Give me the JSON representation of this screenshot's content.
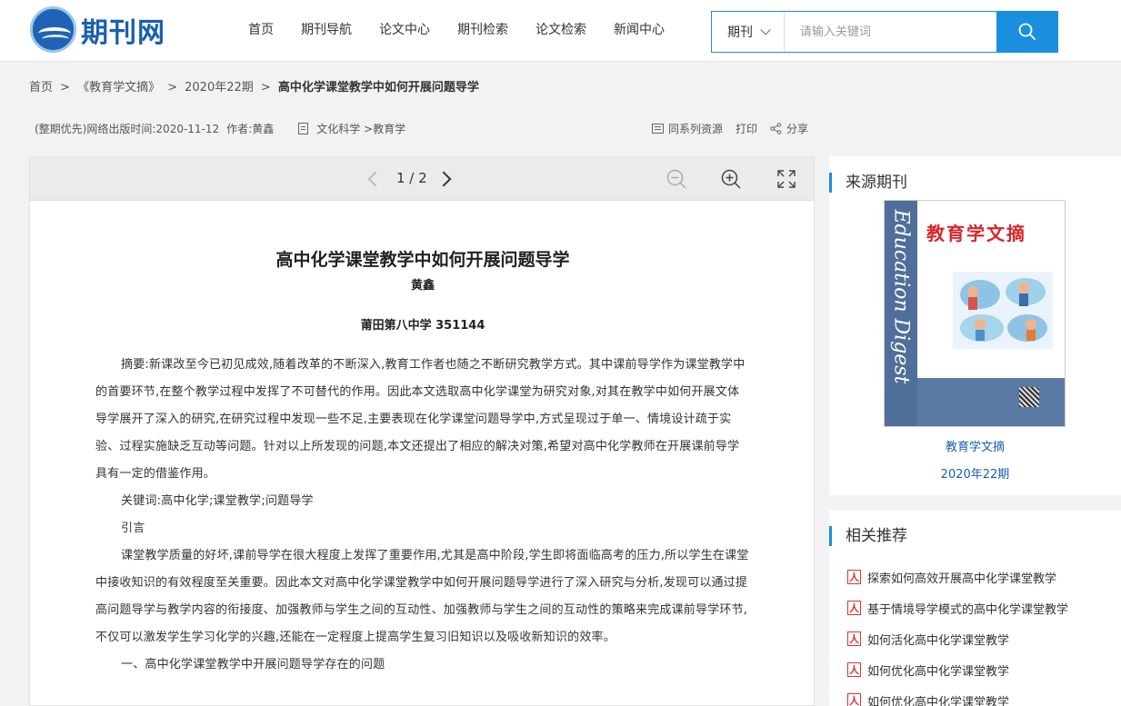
{
  "header": {
    "logo_text": "期刊网",
    "nav": [
      "首页",
      "期刊导航",
      "论文中心",
      "期刊检索",
      "论文检索",
      "新闻中心"
    ],
    "search": {
      "type": "期刊",
      "placeholder": "请输入关键词"
    }
  },
  "breadcrumb": {
    "home": "首页",
    "journal": "《教育学文摘》",
    "issue": "2020年22期",
    "current": "高中化学课堂教学中如何开展问题导学"
  },
  "meta": {
    "priority": "(整期优先)",
    "published_label": "网络出版时间:",
    "published_date": "2020-11-12",
    "author_label": "作者:",
    "author": "黄鑫",
    "category": "文化科学 >教育学"
  },
  "tools": {
    "series": "同系列资源",
    "print": "打印",
    "share": "分享"
  },
  "reader": {
    "page": "1 / 2"
  },
  "document": {
    "title": "高中化学课堂教学中如何开展问题导学",
    "author": "黄鑫",
    "org": "莆田第八中学 351144",
    "abstract": "摘要:新课改至今已初见成效,随着改革的不断深入,教育工作者也随之不断研究教学方式。其中课前导学作为课堂教学中的首要环节,在整个教学过程中发挥了不可替代的作用。因此本文选取高中化学课堂为研究对象,对其在教学中如何开展文体导学展开了深入的研究,在研究过程中发现一些不足,主要表现在化学课堂问题导学中,方式呈现过于单一、情境设计疏于实验、过程实施缺乏互动等问题。针对以上所发现的问题,本文还提出了相应的解决对策,希望对高中化学教师在开展课前导学具有一定的借鉴作用。",
    "keywords": "关键词:高中化学;课堂教学;问题导学",
    "intro_heading": "引言",
    "intro": " 课堂教学质量的好坏,课前导学在很大程度上发挥了重要作用,尤其是高中阶段,学生即将面临高考的压力,所以学生在课堂中接收知识的有效程度至关重要。因此本文对高中化学课堂教学中如何开展问题导学进行了深入研究与分析,发现可以通过提高问题导学与教学内容的衔接度、加强教师与学生之间的互动性、加强教师与学生之间的互动性的策略来完成课前导学环节,不仅可以激发学生学习化学的兴趣,还能在一定程度上提高学生复习旧知识以及吸收新知识的效率。",
    "section1": "一、高中化学课堂教学中开展问题导学存在的问题"
  },
  "sidebar": {
    "source_title": "来源期刊",
    "cover": {
      "title": "教育学文摘",
      "spine": "Education Digest"
    },
    "journal_name": "教育学文摘",
    "journal_issue": "2020年22期",
    "related_title": "相关推荐",
    "related": [
      "探索如何高效开展高中化学课堂教学",
      "基于情境导学模式的高中化学课堂教学",
      "如何活化高中化学课堂教学",
      "如何优化高中化学课堂教学",
      "如何优化高中化学课堂教学"
    ]
  },
  "colors": {
    "accent": "#1a8fe0",
    "link": "#1a5fb0",
    "pdf": "#dd3333"
  }
}
